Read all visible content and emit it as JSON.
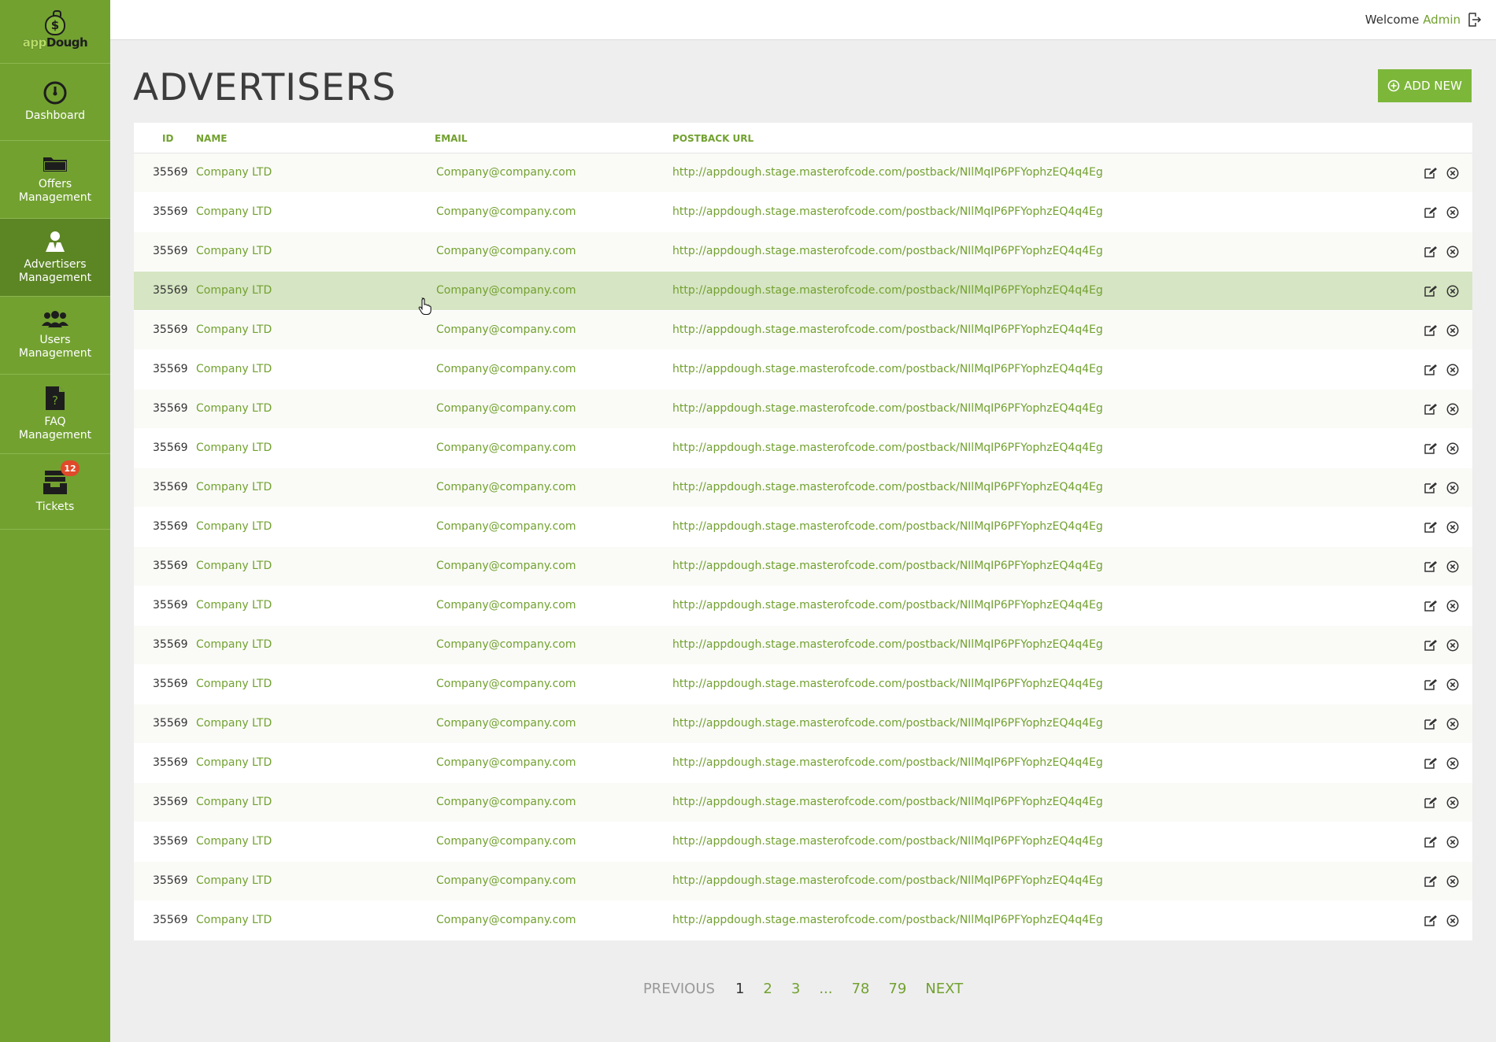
{
  "brand": {
    "logo_app": "app",
    "logo_dough": "Dough",
    "logo_symbol": "$"
  },
  "sidebar": {
    "items": [
      {
        "label": "Dashboard",
        "icon": "gauge-icon",
        "active": false
      },
      {
        "label": "Offers\nManagement",
        "icon": "folder-icon",
        "active": false
      },
      {
        "label": "Advertisers\nManagement",
        "icon": "advertiser-icon",
        "active": true
      },
      {
        "label": "Users\nManagement",
        "icon": "users-icon",
        "active": false
      },
      {
        "label": "FAQ\nManagement",
        "icon": "faq-document-icon",
        "active": false
      },
      {
        "label": "Tickets",
        "icon": "inbox-icon",
        "active": false,
        "badge": "12"
      }
    ]
  },
  "topbar": {
    "welcome": "Welcome",
    "user": "Admin",
    "logout_icon": "logout-icon"
  },
  "page": {
    "title": "ADVERTISERS",
    "add_button": "ADD NEW"
  },
  "table": {
    "headers": {
      "id": "ID",
      "name": "NAME",
      "email": "EMAIL",
      "url": "POSTBACK URL"
    },
    "rows": [
      {
        "id": "35569",
        "name": "Company LTD",
        "email": "Company@company.com",
        "url": "http://appdough.stage.masterofcode.com/postback/NIlMqIP6PFYophzEQ4q4Eg"
      },
      {
        "id": "35569",
        "name": "Company LTD",
        "email": "Company@company.com",
        "url": "http://appdough.stage.masterofcode.com/postback/NIlMqIP6PFYophzEQ4q4Eg"
      },
      {
        "id": "35569",
        "name": "Company LTD",
        "email": "Company@company.com",
        "url": "http://appdough.stage.masterofcode.com/postback/NIlMqIP6PFYophzEQ4q4Eg"
      },
      {
        "id": "35569",
        "name": "Company LTD",
        "email": "Company@company.com",
        "url": "http://appdough.stage.masterofcode.com/postback/NIlMqIP6PFYophzEQ4q4Eg",
        "hover": true
      },
      {
        "id": "35569",
        "name": "Company LTD",
        "email": "Company@company.com",
        "url": "http://appdough.stage.masterofcode.com/postback/NIlMqIP6PFYophzEQ4q4Eg"
      },
      {
        "id": "35569",
        "name": "Company LTD",
        "email": "Company@company.com",
        "url": "http://appdough.stage.masterofcode.com/postback/NIlMqIP6PFYophzEQ4q4Eg"
      },
      {
        "id": "35569",
        "name": "Company LTD",
        "email": "Company@company.com",
        "url": "http://appdough.stage.masterofcode.com/postback/NIlMqIP6PFYophzEQ4q4Eg"
      },
      {
        "id": "35569",
        "name": "Company LTD",
        "email": "Company@company.com",
        "url": "http://appdough.stage.masterofcode.com/postback/NIlMqIP6PFYophzEQ4q4Eg"
      },
      {
        "id": "35569",
        "name": "Company LTD",
        "email": "Company@company.com",
        "url": "http://appdough.stage.masterofcode.com/postback/NIlMqIP6PFYophzEQ4q4Eg"
      },
      {
        "id": "35569",
        "name": "Company LTD",
        "email": "Company@company.com",
        "url": "http://appdough.stage.masterofcode.com/postback/NIlMqIP6PFYophzEQ4q4Eg"
      },
      {
        "id": "35569",
        "name": "Company LTD",
        "email": "Company@company.com",
        "url": "http://appdough.stage.masterofcode.com/postback/NIlMqIP6PFYophzEQ4q4Eg"
      },
      {
        "id": "35569",
        "name": "Company LTD",
        "email": "Company@company.com",
        "url": "http://appdough.stage.masterofcode.com/postback/NIlMqIP6PFYophzEQ4q4Eg"
      },
      {
        "id": "35569",
        "name": "Company LTD",
        "email": "Company@company.com",
        "url": "http://appdough.stage.masterofcode.com/postback/NIlMqIP6PFYophzEQ4q4Eg"
      },
      {
        "id": "35569",
        "name": "Company LTD",
        "email": "Company@company.com",
        "url": "http://appdough.stage.masterofcode.com/postback/NIlMqIP6PFYophzEQ4q4Eg"
      },
      {
        "id": "35569",
        "name": "Company LTD",
        "email": "Company@company.com",
        "url": "http://appdough.stage.masterofcode.com/postback/NIlMqIP6PFYophzEQ4q4Eg"
      },
      {
        "id": "35569",
        "name": "Company LTD",
        "email": "Company@company.com",
        "url": "http://appdough.stage.masterofcode.com/postback/NIlMqIP6PFYophzEQ4q4Eg"
      },
      {
        "id": "35569",
        "name": "Company LTD",
        "email": "Company@company.com",
        "url": "http://appdough.stage.masterofcode.com/postback/NIlMqIP6PFYophzEQ4q4Eg"
      },
      {
        "id": "35569",
        "name": "Company LTD",
        "email": "Company@company.com",
        "url": "http://appdough.stage.masterofcode.com/postback/NIlMqIP6PFYophzEQ4q4Eg"
      },
      {
        "id": "35569",
        "name": "Company LTD",
        "email": "Company@company.com",
        "url": "http://appdough.stage.masterofcode.com/postback/NIlMqIP6PFYophzEQ4q4Eg"
      },
      {
        "id": "35569",
        "name": "Company LTD",
        "email": "Company@company.com",
        "url": "http://appdough.stage.masterofcode.com/postback/NIlMqIP6PFYophzEQ4q4Eg"
      }
    ],
    "row_actions": [
      "edit-icon",
      "delete-icon"
    ]
  },
  "pagination": {
    "previous": "PREVIOUS",
    "current": "1",
    "pages": [
      "2",
      "3"
    ],
    "ellipsis": "...",
    "last_pages": [
      "78",
      "79"
    ],
    "next": "NEXT"
  },
  "colors": {
    "sidebar": "#72a130",
    "sidebar_active": "#5c8524",
    "accent": "#72a130",
    "add_button": "#7db73a",
    "row_hover": "#d6e5c3",
    "badge": "#e04a2a"
  }
}
